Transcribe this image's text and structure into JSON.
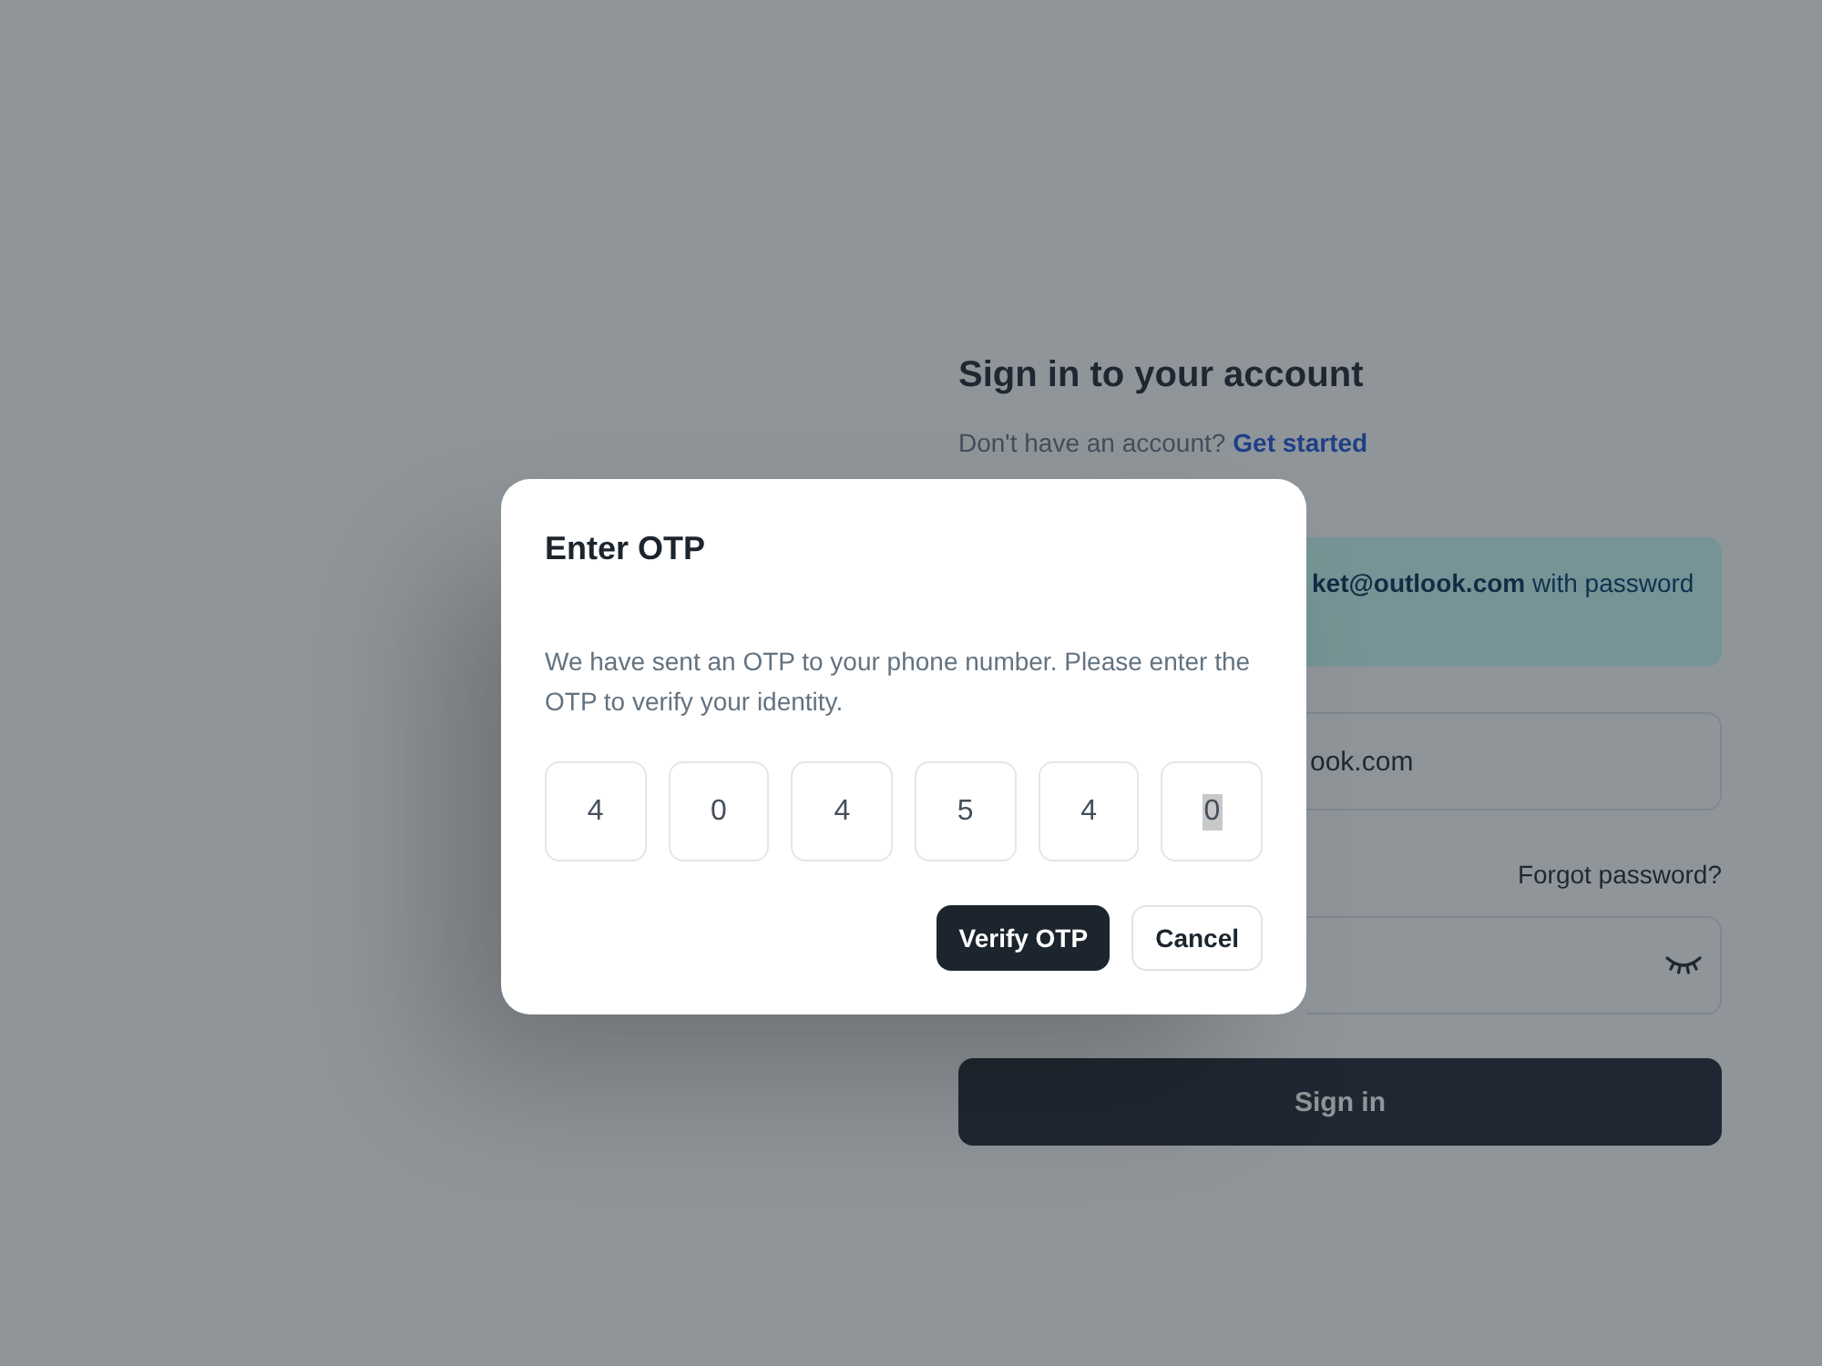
{
  "sign_in": {
    "title": "Sign in to your account",
    "signup_prompt": "Don't have an account?",
    "signup_link": "Get started",
    "alert": "**ket@outlook.com** with password",
    "email_field": {
      "value": "ook.com"
    },
    "forgot_password_link": "Forgot password?",
    "sign_in_button": "Sign in"
  },
  "dialog": {
    "title": "Enter OTP",
    "message": "We have sent an OTP to your phone number. Please enter the OTP to verify your identity.",
    "otp_digits": [
      {
        "value": "4",
        "selected": false
      },
      {
        "value": "0",
        "selected": false
      },
      {
        "value": "4",
        "selected": false
      },
      {
        "value": "5",
        "selected": false
      },
      {
        "value": "4",
        "selected": false
      },
      {
        "value": "0",
        "selected": true
      }
    ],
    "buttons": [
      {
        "label": "Verify OTP",
        "kind": "primary"
      },
      {
        "label": "Cancel",
        "kind": "outlined"
      }
    ]
  }
}
